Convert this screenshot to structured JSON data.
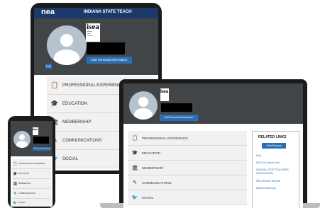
{
  "brand": {
    "logo": "nea",
    "title": "INDIANA STATE TEACH"
  },
  "logo": {
    "main": "isea",
    "lines": [
      "Indiana",
      "State",
      "Teachers",
      "Association"
    ]
  },
  "profile": {
    "edit_label": "Edit",
    "edit_info_button": "Edit Personal Information"
  },
  "menu": [
    {
      "label": "PROFESSIONAL EXPERIENCE",
      "icon": "clipboard-icon"
    },
    {
      "label": "EDUCATION",
      "icon": "graduation-cap-icon"
    },
    {
      "label": "MEMBERSHIP",
      "icon": "building-columns-icon"
    },
    {
      "label": "COMMUNICATIONS",
      "icon": "pen-icon"
    },
    {
      "label": "SOCIAL",
      "icon": "bird-icon"
    }
  ],
  "related": {
    "title": "RELATED LINKS",
    "button": "Print Resume",
    "links": [
      "Help",
      "NEA EdCareers Jobs",
      "INDIANA STATE TEACHERS ASSOCIATION",
      "NEA Member Benefits",
      "National Directory"
    ]
  },
  "colors": {
    "header": "#1b3a69",
    "accent": "#2b6fb5",
    "panel": "#424547",
    "menu_bg": "#f1f1f1"
  }
}
